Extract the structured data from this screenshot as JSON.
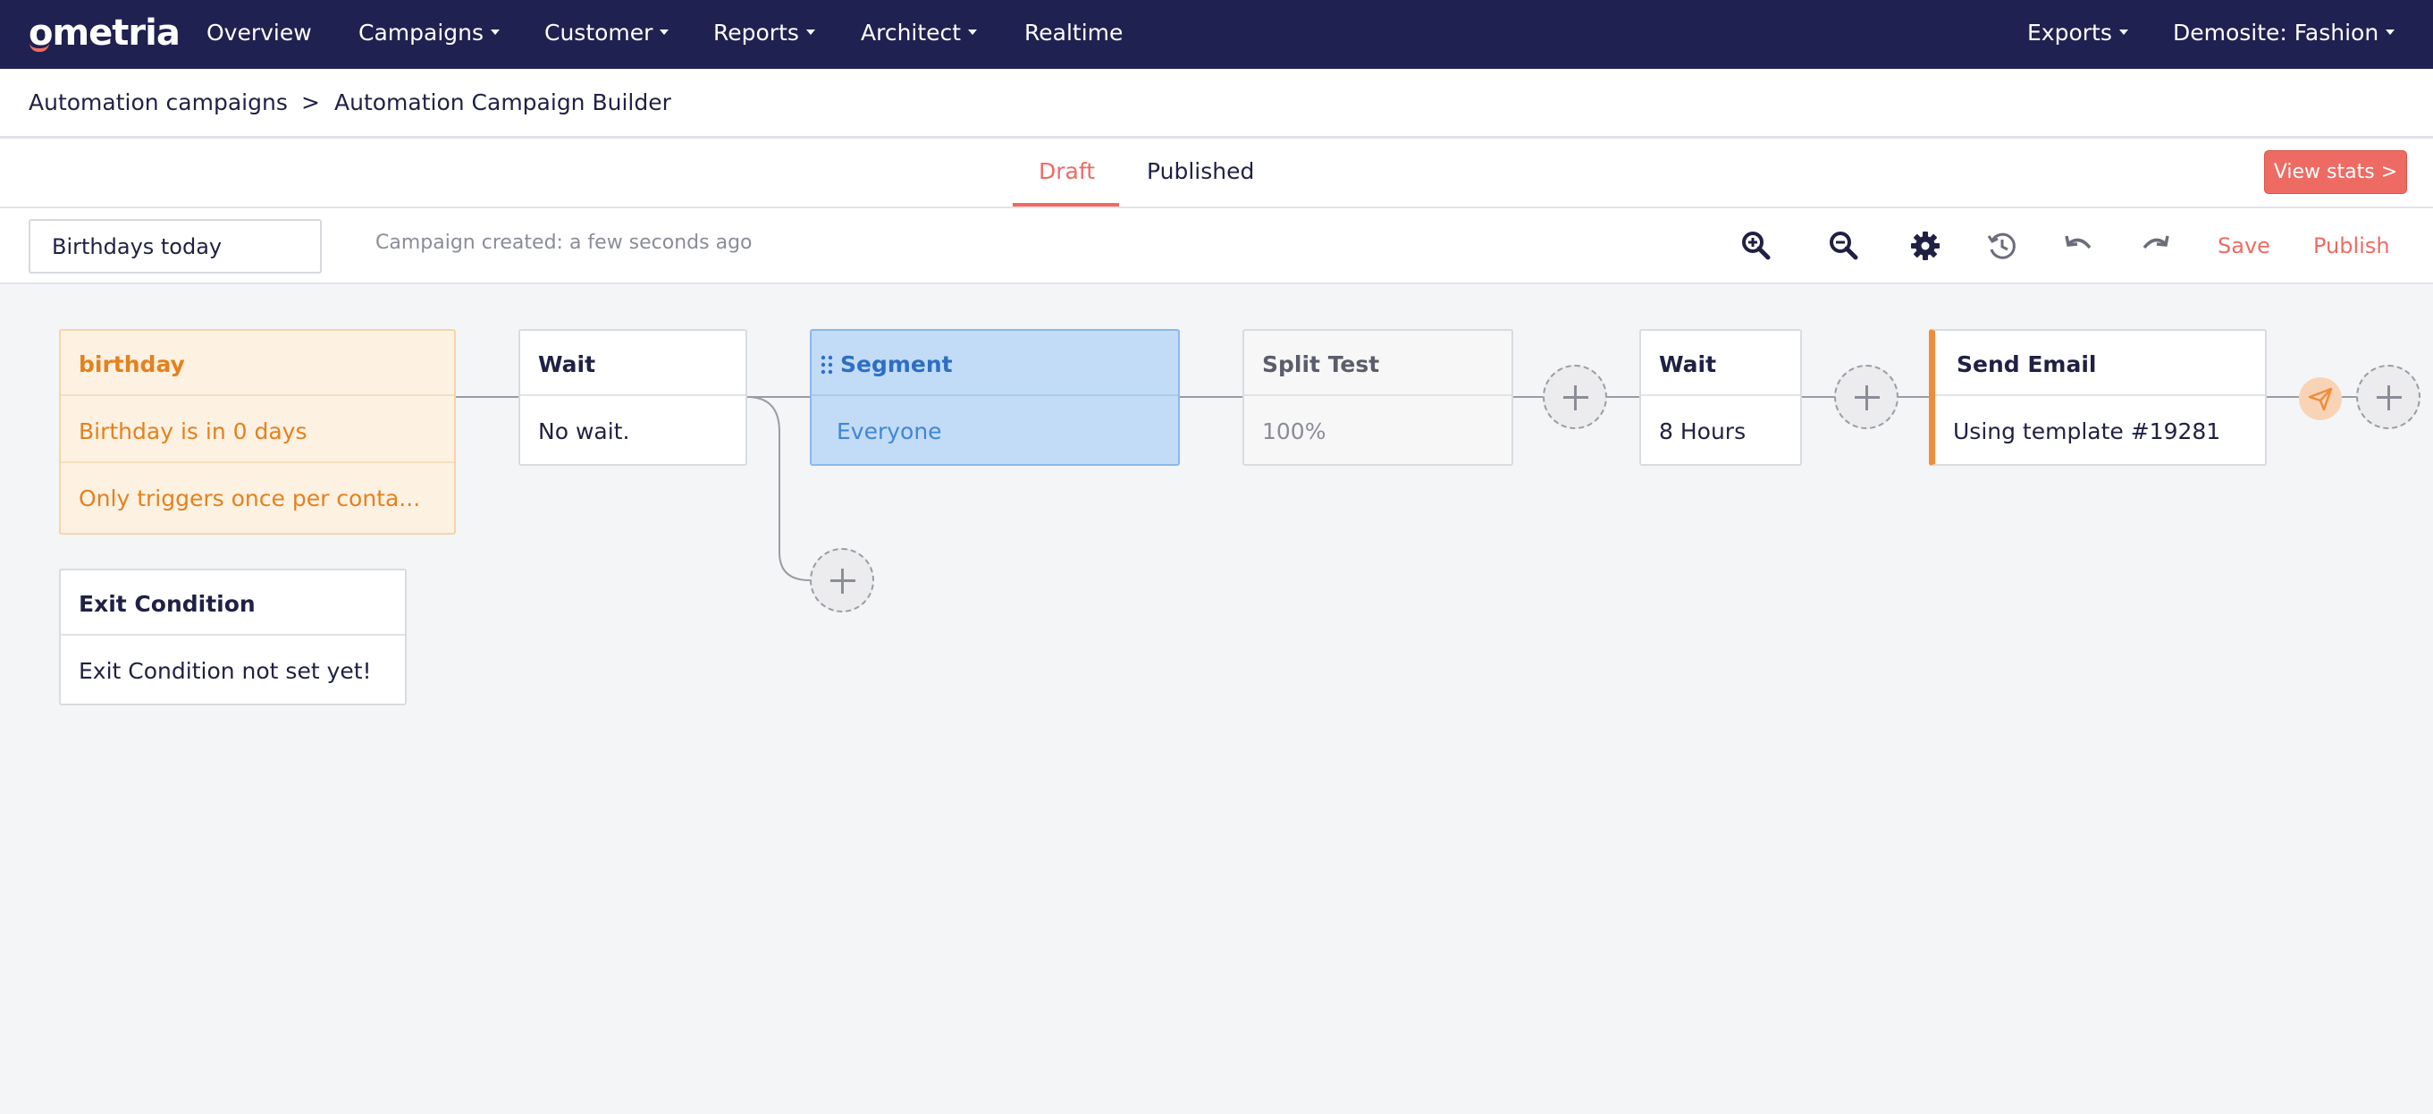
{
  "nav": {
    "logo": "ometria",
    "items": [
      {
        "label": "Overview",
        "has_caret": false
      },
      {
        "label": "Campaigns",
        "has_caret": true
      },
      {
        "label": "Customer",
        "has_caret": true
      },
      {
        "label": "Reports",
        "has_caret": true
      },
      {
        "label": "Architect",
        "has_caret": true
      },
      {
        "label": "Realtime",
        "has_caret": false
      }
    ],
    "right": [
      {
        "label": "Exports",
        "has_caret": true
      },
      {
        "label": "Demosite: Fashion",
        "has_caret": true
      }
    ]
  },
  "breadcrumb": {
    "items": [
      "Automation campaigns",
      "Automation Campaign Builder"
    ],
    "separator": ">"
  },
  "tabs": [
    {
      "label": "Draft",
      "active": true
    },
    {
      "label": "Published",
      "active": false
    }
  ],
  "view_stats_label": "View stats >",
  "toolbar": {
    "campaign_name": "Birthdays today",
    "created_text": "Campaign created: a few seconds ago",
    "icons": [
      "zoom-in-icon",
      "zoom-out-icon",
      "settings-gear-icon",
      "history-icon",
      "undo-icon",
      "redo-icon"
    ],
    "save_label": "Save",
    "publish_label": "Publish"
  },
  "nodes": {
    "trigger": {
      "title": "birthday",
      "line1": "Birthday is in 0 days",
      "line2": "Only triggers once per conta..."
    },
    "wait1": {
      "title": "Wait",
      "body": "No wait."
    },
    "segment": {
      "title": "Segment",
      "body": "Everyone"
    },
    "split": {
      "title": "Split Test",
      "body": "100%"
    },
    "wait2": {
      "title": "Wait",
      "body": "8 Hours"
    },
    "email": {
      "title": "Send Email",
      "body": "Using template #19281"
    },
    "exit": {
      "title": "Exit Condition",
      "body": "Exit Condition not set yet!"
    }
  },
  "colors": {
    "nav_bg": "#1f2150",
    "accent": "#ee6b63",
    "trigger_bg": "#fdf1e1",
    "trigger_text": "#e4811e",
    "segment_bg": "#c2dbf6",
    "email_border": "#ef8d3b"
  }
}
